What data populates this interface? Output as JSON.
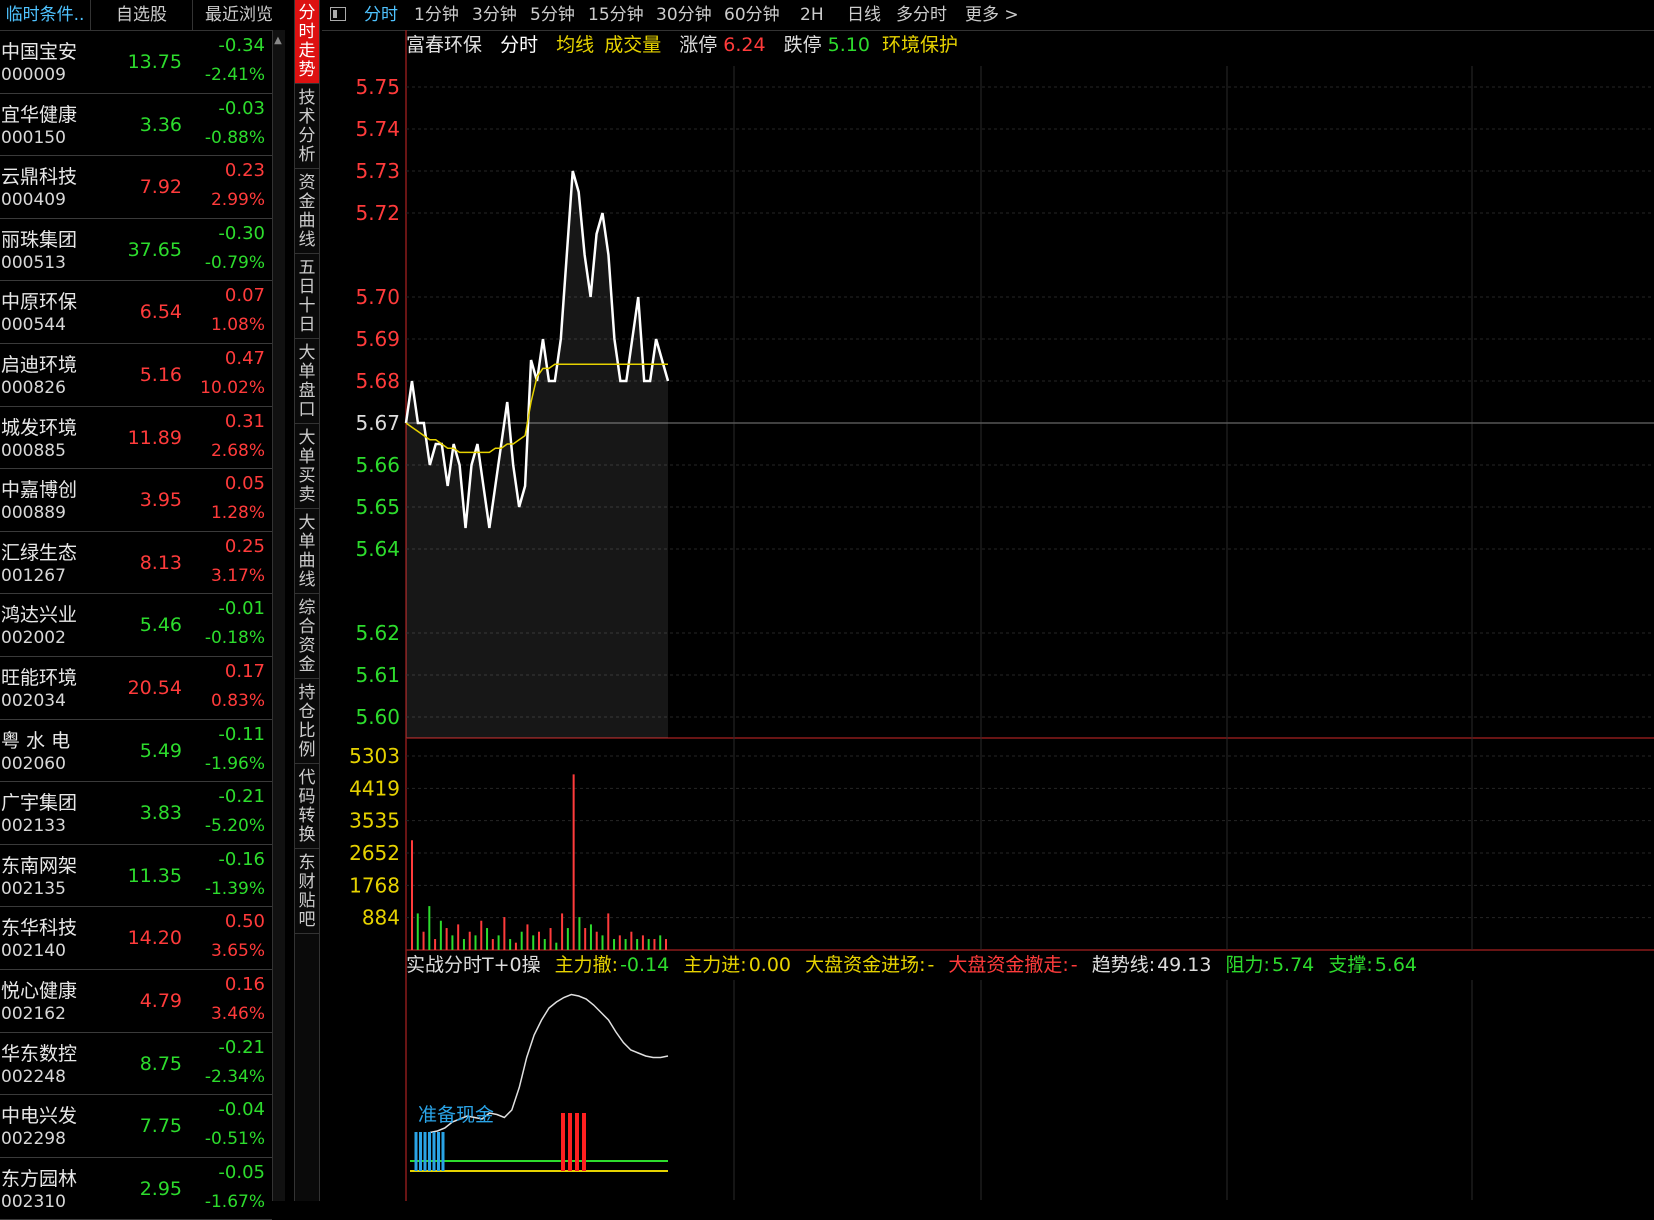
{
  "stock_list": {
    "tabs": [
      "临时条件..",
      "自选股",
      "最近浏览"
    ],
    "active_tab": 0,
    "rows": [
      {
        "name": "中国宝安",
        "code": "000009",
        "price": "13.75",
        "change": "-0.34",
        "pct": "-2.41%",
        "dir": "down"
      },
      {
        "name": "宜华健康",
        "code": "000150",
        "price": "3.36",
        "change": "-0.03",
        "pct": "-0.88%",
        "dir": "down"
      },
      {
        "name": "云鼎科技",
        "code": "000409",
        "price": "7.92",
        "change": "0.23",
        "pct": "2.99%",
        "dir": "up"
      },
      {
        "name": "丽珠集团",
        "code": "000513",
        "price": "37.65",
        "change": "-0.30",
        "pct": "-0.79%",
        "dir": "down"
      },
      {
        "name": "中原环保",
        "code": "000544",
        "price": "6.54",
        "change": "0.07",
        "pct": "1.08%",
        "dir": "up"
      },
      {
        "name": "启迪环境",
        "code": "000826",
        "price": "5.16",
        "change": "0.47",
        "pct": "10.02%",
        "dir": "up"
      },
      {
        "name": "城发环境",
        "code": "000885",
        "price": "11.89",
        "change": "0.31",
        "pct": "2.68%",
        "dir": "up"
      },
      {
        "name": "中嘉博创",
        "code": "000889",
        "price": "3.95",
        "change": "0.05",
        "pct": "1.28%",
        "dir": "up"
      },
      {
        "name": "汇绿生态",
        "code": "001267",
        "price": "8.13",
        "change": "0.25",
        "pct": "3.17%",
        "dir": "up"
      },
      {
        "name": "鸿达兴业",
        "code": "002002",
        "price": "5.46",
        "change": "-0.01",
        "pct": "-0.18%",
        "dir": "down"
      },
      {
        "name": "旺能环境",
        "code": "002034",
        "price": "20.54",
        "change": "0.17",
        "pct": "0.83%",
        "dir": "up"
      },
      {
        "name": "粤 水 电",
        "code": "002060",
        "price": "5.49",
        "change": "-0.11",
        "pct": "-1.96%",
        "dir": "down"
      },
      {
        "name": "广宇集团",
        "code": "002133",
        "price": "3.83",
        "change": "-0.21",
        "pct": "-5.20%",
        "dir": "down"
      },
      {
        "name": "东南网架",
        "code": "002135",
        "price": "11.35",
        "change": "-0.16",
        "pct": "-1.39%",
        "dir": "down"
      },
      {
        "name": "东华科技",
        "code": "002140",
        "price": "14.20",
        "change": "0.50",
        "pct": "3.65%",
        "dir": "up"
      },
      {
        "name": "悦心健康",
        "code": "002162",
        "price": "4.79",
        "change": "0.16",
        "pct": "3.46%",
        "dir": "up"
      },
      {
        "name": "华东数控",
        "code": "002248",
        "price": "8.75",
        "change": "-0.21",
        "pct": "-2.34%",
        "dir": "down"
      },
      {
        "name": "中电兴发",
        "code": "002298",
        "price": "7.75",
        "change": "-0.04",
        "pct": "-0.51%",
        "dir": "down"
      },
      {
        "name": "东方园林",
        "code": "002310",
        "price": "2.95",
        "change": "-0.05",
        "pct": "-1.67%",
        "dir": "down"
      }
    ]
  },
  "vertical_tabs": [
    "分时走势",
    "技术分析",
    "资金曲线",
    "五日十日",
    "大单盘口",
    "大单买卖",
    "大单曲线",
    "综合资金",
    "持仓比例",
    "代码转换",
    "东财贴吧"
  ],
  "active_vertical_tab": 0,
  "periods": [
    "分时",
    "1分钟",
    "3分钟",
    "5分钟",
    "15分钟",
    "30分钟",
    "60分钟",
    "2H",
    "日线",
    "多分时",
    "更多 >"
  ],
  "active_period": 0,
  "header": {
    "stock_name": "富春环保",
    "mode": "分时",
    "avg_line_label": "均线",
    "volume_label": "成交量",
    "limit_up_label": "涨停",
    "limit_up_value": "6.24",
    "limit_down_label": "跌停",
    "limit_down_value": "5.10",
    "sector": "环境保护"
  },
  "indicator": {
    "name": "实战分时T+0操",
    "main_out_label": "主力撤:",
    "main_out_value": "-0.14",
    "main_in_label": "主力进:",
    "main_in_value": "0.00",
    "market_in_label": "大盘资金进场:",
    "market_in_value": "-",
    "market_out_label": "大盘资金撤走:",
    "market_out_value": "-",
    "trend_label": "趋势线:",
    "trend_value": "49.13",
    "resist_label": "阻力:",
    "resist_value": "5.74",
    "support_label": "支撑:",
    "support_value": "5.64",
    "prepare_cash": "准备现金"
  },
  "colors": {
    "up": "#ff3b3b",
    "down": "#2ddc2d",
    "avg_line": "#e6d200",
    "price_line": "#ffffff",
    "accent": "#4fc3ff",
    "active_tab_bg": "#dd1111"
  },
  "chart_data": [
    {
      "type": "line",
      "title": "富春环保 分时",
      "prev_close": 5.67,
      "y_ticks": [
        "5.75",
        "5.74",
        "5.73",
        "5.72",
        "5.70",
        "5.69",
        "5.68",
        "5.67",
        "5.66",
        "5.65",
        "5.64",
        "5.62",
        "5.61",
        "5.60"
      ],
      "ylim": [
        5.595,
        5.755
      ],
      "series": [
        {
          "name": "price",
          "values": [
            5.67,
            5.68,
            5.67,
            5.67,
            5.66,
            5.665,
            5.665,
            5.655,
            5.665,
            5.66,
            5.645,
            5.66,
            5.665,
            5.655,
            5.645,
            5.655,
            5.665,
            5.675,
            5.66,
            5.65,
            5.655,
            5.685,
            5.68,
            5.69,
            5.68,
            5.68,
            5.69,
            5.71,
            5.73,
            5.725,
            5.71,
            5.7,
            5.715,
            5.72,
            5.71,
            5.69,
            5.68,
            5.68,
            5.69,
            5.7,
            5.68,
            5.68,
            5.69,
            5.685,
            5.68
          ]
        },
        {
          "name": "均线",
          "values": [
            5.67,
            5.669,
            5.668,
            5.667,
            5.666,
            5.666,
            5.665,
            5.664,
            5.664,
            5.663,
            5.663,
            5.663,
            5.663,
            5.663,
            5.663,
            5.664,
            5.664,
            5.665,
            5.665,
            5.666,
            5.667,
            5.675,
            5.681,
            5.683,
            5.683,
            5.684,
            5.684,
            5.684,
            5.684,
            5.684,
            5.684,
            5.684,
            5.684,
            5.684,
            5.684,
            5.684,
            5.684,
            5.684,
            5.684,
            5.684,
            5.684,
            5.684,
            5.684,
            5.684,
            5.684
          ]
        }
      ]
    },
    {
      "type": "bar",
      "title": "成交量",
      "y_ticks": [
        "5303",
        "4419",
        "3535",
        "2652",
        "1768",
        "884"
      ],
      "ylim": [
        0,
        5303
      ],
      "values": [
        3000,
        1000,
        500,
        1200,
        300,
        800,
        600,
        400,
        700,
        300,
        500,
        400,
        800,
        600,
        300,
        400,
        900,
        300,
        200,
        500,
        700,
        400,
        500,
        300,
        600,
        200,
        1000,
        600,
        4800,
        900,
        600,
        700,
        500,
        400,
        1000,
        300,
        400,
        300,
        500,
        300,
        400,
        300,
        300,
        400,
        300
      ],
      "directions": [
        "up",
        "down",
        "up",
        "down",
        "up",
        "down",
        "up",
        "down",
        "up",
        "down",
        "up",
        "down",
        "up",
        "down",
        "up",
        "down",
        "up",
        "down",
        "up",
        "down",
        "up",
        "down",
        "up",
        "down",
        "up",
        "down",
        "up",
        "down",
        "up",
        "down",
        "up",
        "down",
        "up",
        "down",
        "up",
        "down",
        "up",
        "down",
        "up",
        "down",
        "up",
        "down",
        "up",
        "down",
        "up"
      ]
    },
    {
      "type": "line",
      "title": "实战分时T+0操",
      "series": [
        {
          "name": "趋势线",
          "values": [
            5,
            6,
            8,
            12,
            14,
            16,
            15,
            14,
            18,
            17,
            15,
            20,
            35,
            55,
            70,
            80,
            88,
            92,
            95,
            97,
            96,
            94,
            90,
            85,
            80,
            72,
            65,
            60,
            58,
            56,
            55,
            55,
            56
          ]
        }
      ],
      "ylim": [
        0,
        100
      ],
      "blue_bars": [
        0,
        1,
        2,
        3,
        4,
        5,
        6
      ],
      "red_bars": [
        13,
        14,
        15,
        16
      ]
    }
  ]
}
